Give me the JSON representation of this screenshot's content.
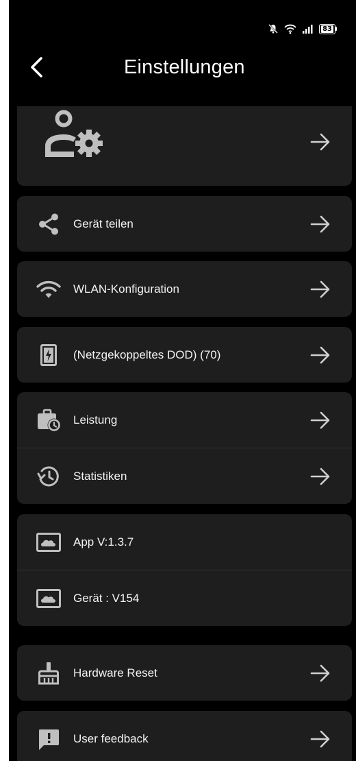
{
  "status": {
    "battery": "83"
  },
  "header": {
    "title": "Einstellungen"
  },
  "rows": {
    "share": {
      "label": "Gerät teilen"
    },
    "wlan": {
      "label": "WLAN-Konfiguration"
    },
    "dod": {
      "label": "(Netzgekoppeltes DOD)  (70)"
    },
    "power": {
      "label": "Leistung"
    },
    "stats": {
      "label": "Statistiken"
    },
    "app_version": {
      "label": "App V:1.3.7"
    },
    "device_version": {
      "label": "Gerät : V154"
    },
    "reset": {
      "label": "Hardware Reset"
    },
    "feedback": {
      "label": "User feedback"
    }
  },
  "icons": {
    "profile": "user-settings-icon",
    "share": "share-icon",
    "wlan": "wifi-icon",
    "dod": "battery-charge-icon",
    "power": "briefcase-clock-icon",
    "stats": "history-icon",
    "version": "cloud-image-icon",
    "reset": "broom-icon",
    "feedback": "feedback-icon",
    "arrow": "arrow-right-icon",
    "back": "chevron-left-icon"
  },
  "colors": {
    "background": "#000000",
    "card": "#1e1e1e",
    "text": "#f2f2f2",
    "icon": "#bfbfbf"
  }
}
